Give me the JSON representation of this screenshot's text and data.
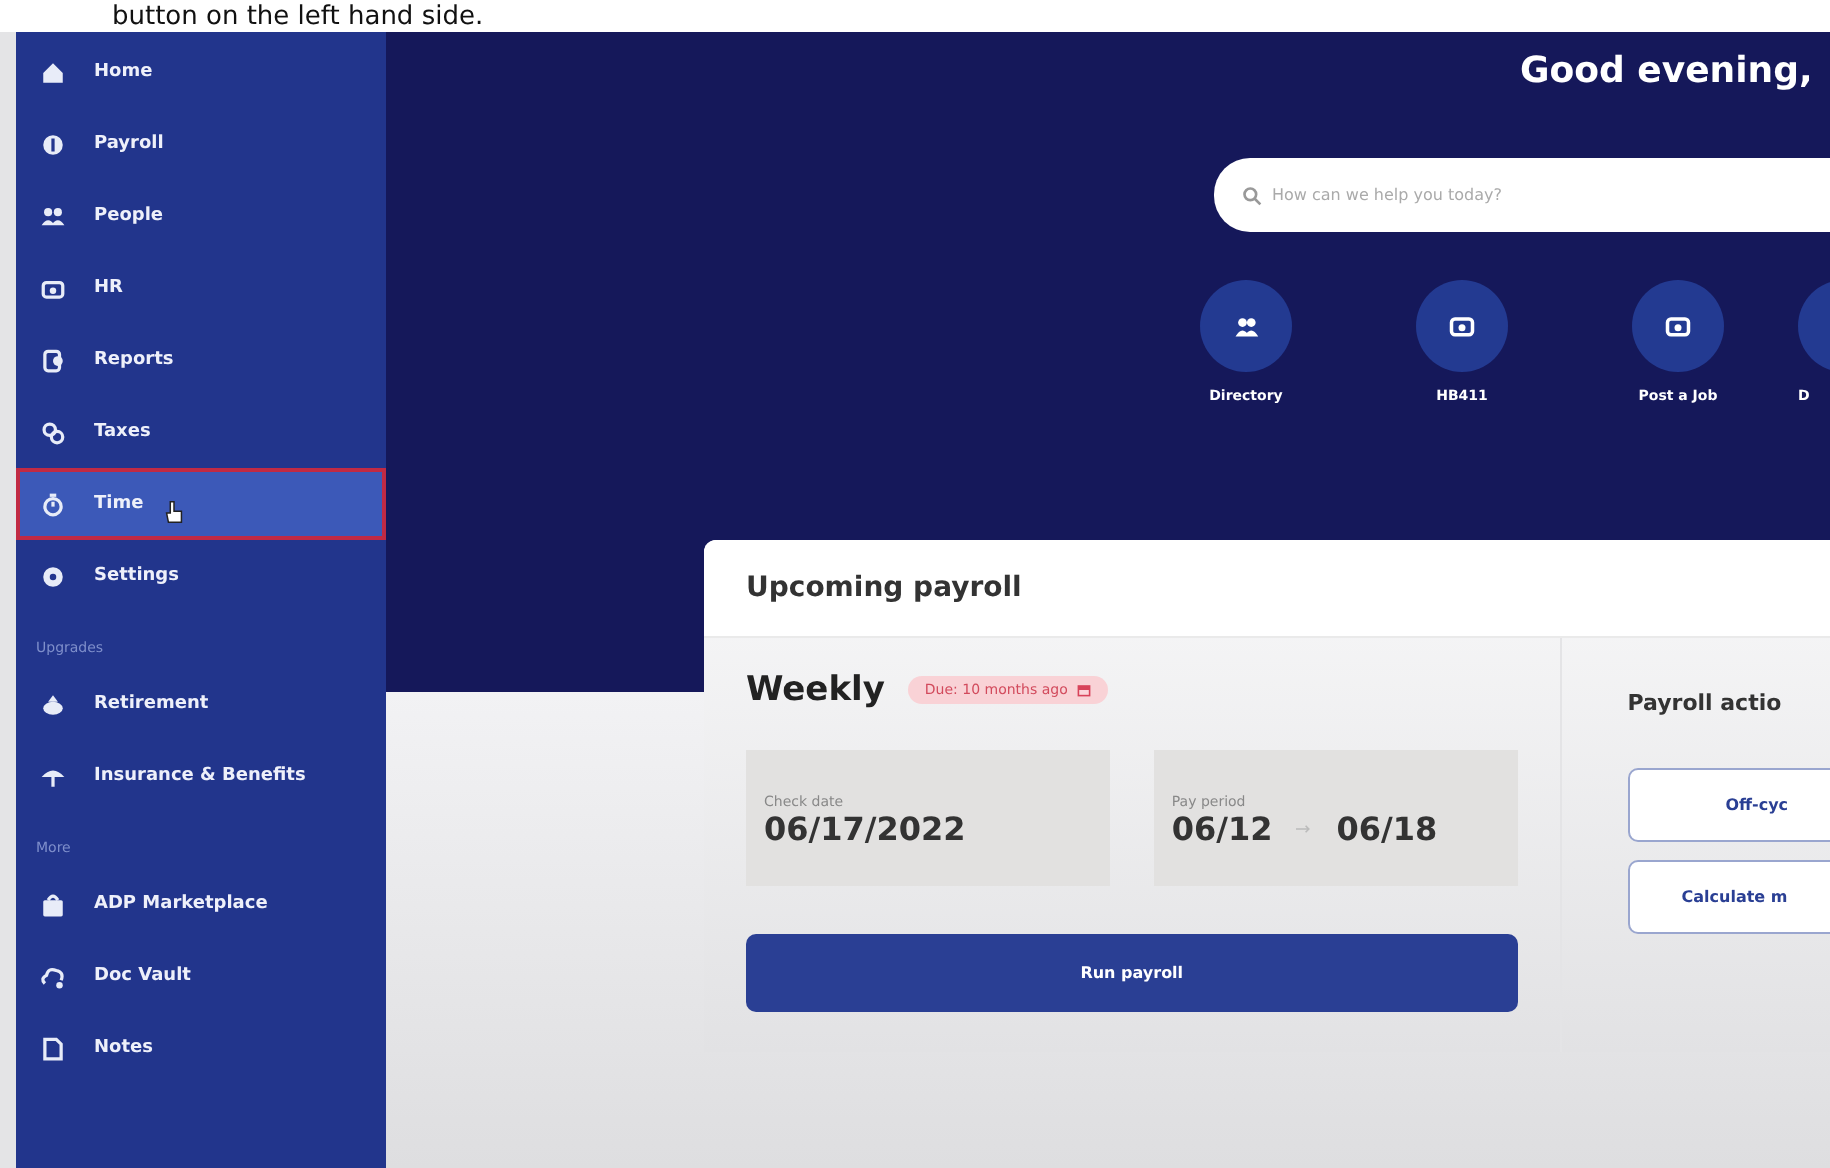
{
  "caption": "button on the left hand side.",
  "sidebar": {
    "items": [
      {
        "kind": "item",
        "label": "Home",
        "selected": false
      },
      {
        "kind": "item",
        "label": "Payroll",
        "selected": false
      },
      {
        "kind": "item",
        "label": "People",
        "selected": false
      },
      {
        "kind": "item",
        "label": "HR",
        "selected": false
      },
      {
        "kind": "item",
        "label": "Reports",
        "selected": false
      },
      {
        "kind": "item",
        "label": "Taxes",
        "selected": false
      },
      {
        "kind": "item",
        "label": "Time",
        "selected": true
      },
      {
        "kind": "item",
        "label": "Settings",
        "selected": false
      },
      {
        "kind": "heading",
        "label": "Upgrades"
      },
      {
        "kind": "item",
        "label": "Retirement",
        "selected": false
      },
      {
        "kind": "item",
        "label": "Insurance & Benefits",
        "selected": false
      },
      {
        "kind": "heading",
        "label": "More"
      },
      {
        "kind": "item",
        "label": "ADP Marketplace",
        "selected": false
      },
      {
        "kind": "item",
        "label": "Doc Vault",
        "selected": false
      },
      {
        "kind": "item",
        "label": "Notes",
        "selected": false
      }
    ]
  },
  "greeting": "Good evening,",
  "search": {
    "placeholder": "How can we help you today?"
  },
  "quick_links": [
    {
      "label": "Directory"
    },
    {
      "label": "HB411"
    },
    {
      "label": "Post a Job"
    },
    {
      "label": "D"
    }
  ],
  "payroll_card": {
    "title": "Upcoming payroll",
    "frequency": "Weekly",
    "due_badge": "Due: 10 months ago",
    "check_date": {
      "label": "Check date",
      "value": "06/17/2022"
    },
    "pay_period": {
      "label": "Pay period",
      "start": "06/12",
      "end": "06/18"
    },
    "run_button": "Run payroll",
    "actions_title": "Payroll actio",
    "actions": [
      "Off-cyc",
      "Calculate m"
    ]
  }
}
